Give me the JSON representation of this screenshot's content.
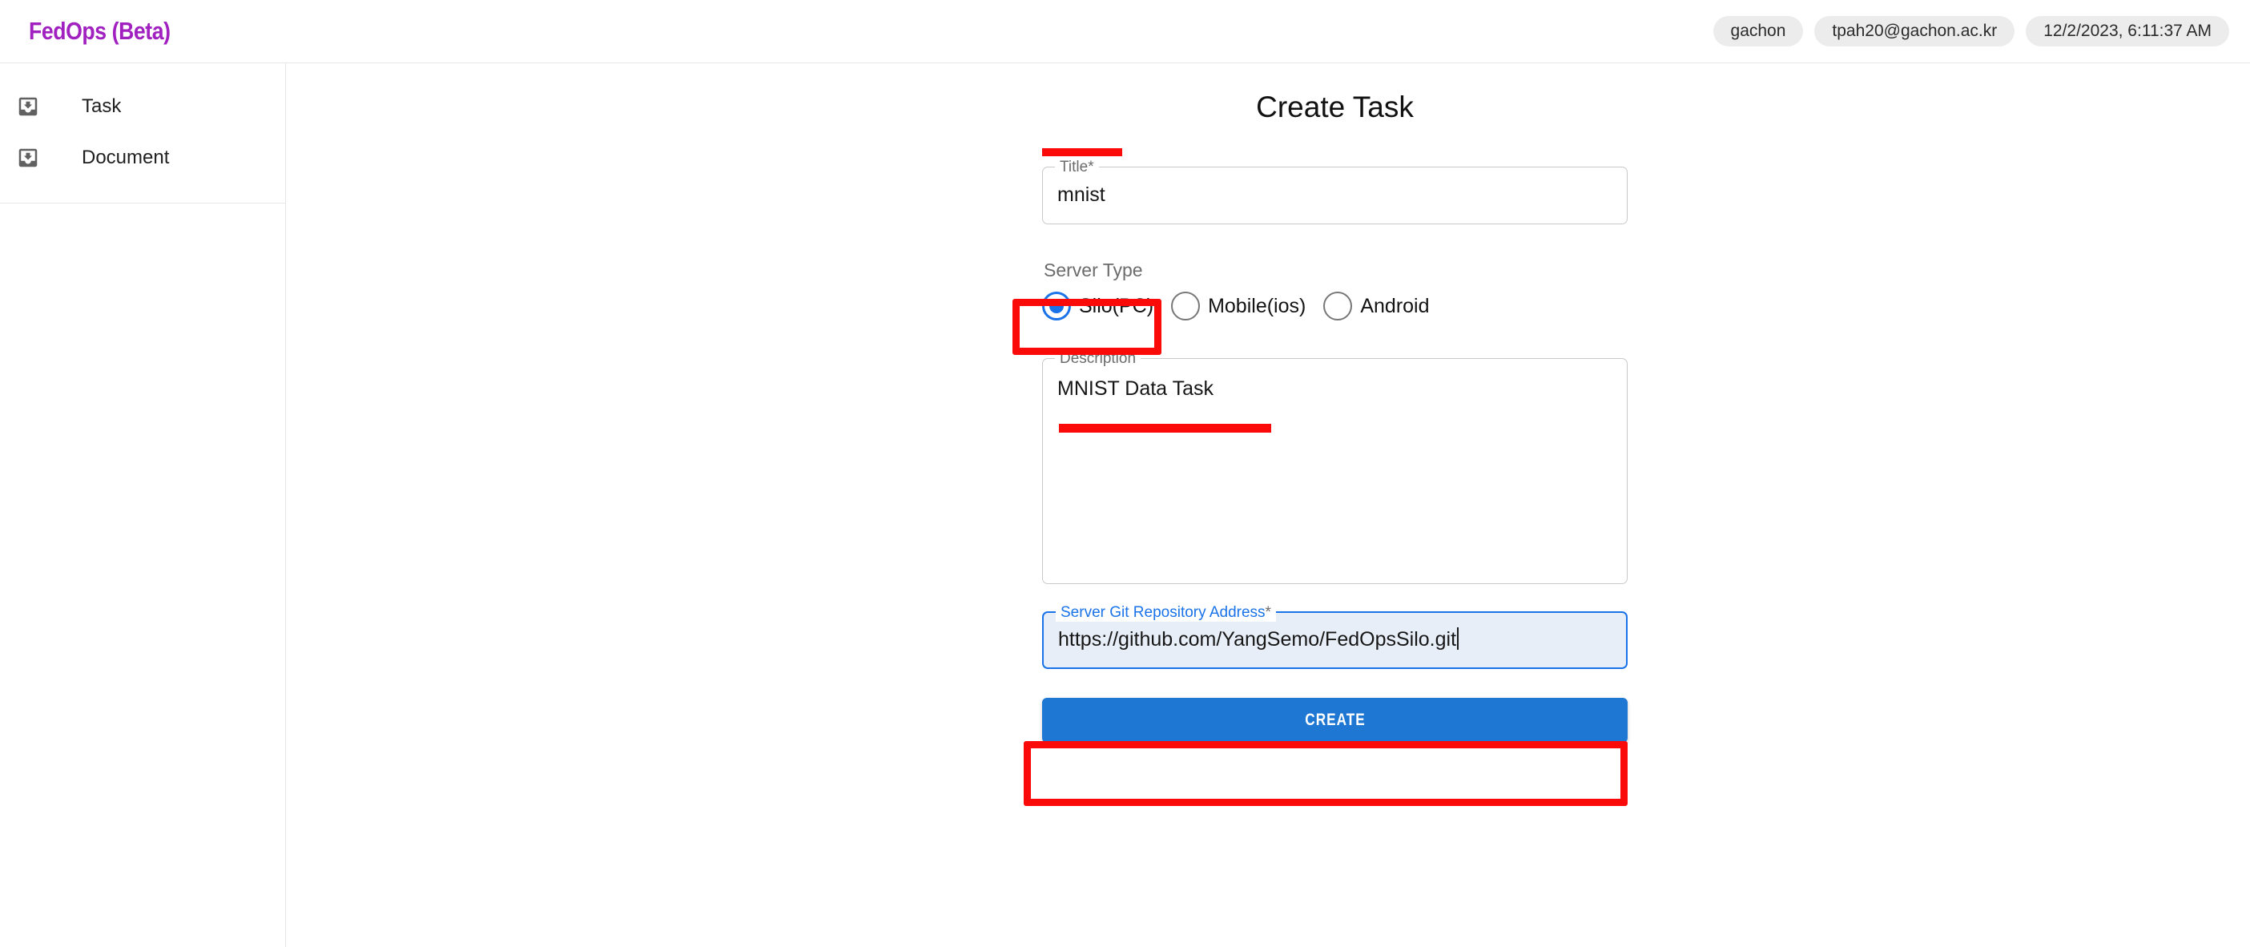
{
  "header": {
    "brand": "FedOps (Beta)",
    "chips": [
      {
        "name": "org-chip",
        "label": "gachon"
      },
      {
        "name": "email-chip",
        "label": "tpah20@gachon.ac.kr"
      },
      {
        "name": "timestamp-chip",
        "label": "12/2/2023, 6:11:37 AM"
      }
    ]
  },
  "sidebar": {
    "items": [
      {
        "icon": "move-to-inbox-icon",
        "label": "Task"
      },
      {
        "icon": "move-to-inbox-icon",
        "label": "Document"
      }
    ]
  },
  "main": {
    "title": "Create Task",
    "fields": {
      "title": {
        "label": "Title",
        "required_mark": "*",
        "value": "mnist",
        "placeholder": ""
      },
      "description": {
        "label": "Description",
        "required_mark": "",
        "value": "MNIST Data Task",
        "placeholder": ""
      },
      "git": {
        "label": "Server Git Repository Address",
        "required_mark": "*",
        "value": "https://github.com/YangSemo/FedOpsSilo.git",
        "placeholder": ""
      }
    },
    "server_type": {
      "label": "Server Type",
      "selected": "Silo(PC)",
      "options": [
        {
          "label": "Silo(PC)",
          "checked": true
        },
        {
          "label": "Mobile(ios)",
          "checked": false
        },
        {
          "label": "Android",
          "checked": false
        }
      ]
    },
    "submit": {
      "label": "CREATE"
    }
  },
  "annotations": {
    "color": "#fb0a0a",
    "items": [
      {
        "name": "title-underline-annotation",
        "kind": "underline"
      },
      {
        "name": "server-type-rect-annotation",
        "kind": "rect"
      },
      {
        "name": "description-underline-annotation",
        "kind": "underline"
      },
      {
        "name": "git-rect-annotation",
        "kind": "rect"
      }
    ]
  },
  "colors": {
    "brand": "#a020c0",
    "accent": "#1a73e8",
    "button": "#1e77d3",
    "annotation": "#fb0a0a",
    "chip_bg": "#ececec"
  }
}
